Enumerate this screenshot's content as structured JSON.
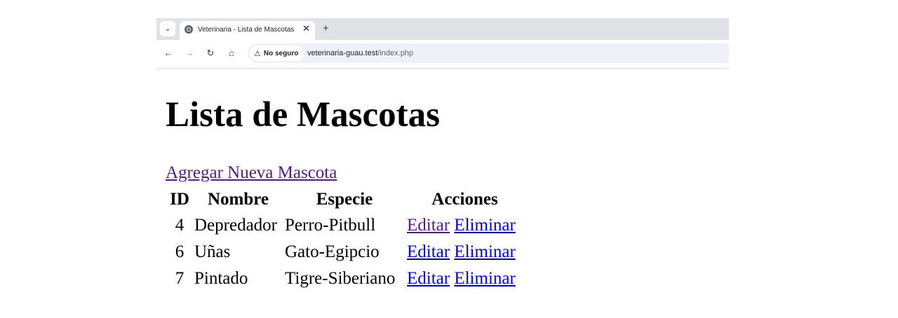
{
  "browser": {
    "tab_title": "Veterinaria - Lista de Mascotas",
    "security_label": "No seguro",
    "url_host": "veterinaria-guau.test",
    "url_path": "/index.php"
  },
  "page": {
    "title": "Lista de Mascotas",
    "add_link": "Agregar Nueva Mascota"
  },
  "table": {
    "headers": [
      "ID",
      "Nombre",
      "Especie",
      "Acciones"
    ],
    "rows": [
      {
        "id": "4",
        "nombre": "Depredador",
        "especie": "Perro-Pitbull",
        "edit": "Editar",
        "delete": "Eliminar"
      },
      {
        "id": "6",
        "nombre": "Uñas",
        "especie": "Gato-Egipcio",
        "edit": "Editar",
        "delete": "Eliminar"
      },
      {
        "id": "7",
        "nombre": "Pintado",
        "especie": "Tigre-Siberiano",
        "edit": "Editar",
        "delete": "Eliminar"
      }
    ]
  },
  "colors": {
    "link": "#0000ee",
    "visited_link": "#551a8b",
    "tabstrip": "#dfe3e8",
    "omnibox": "#eef1f9"
  },
  "icons": [
    "tab-search-icon",
    "globe-icon",
    "close-icon",
    "plus-icon",
    "back-arrow-icon",
    "forward-arrow-icon",
    "reload-icon",
    "home-icon",
    "warning-icon"
  ]
}
